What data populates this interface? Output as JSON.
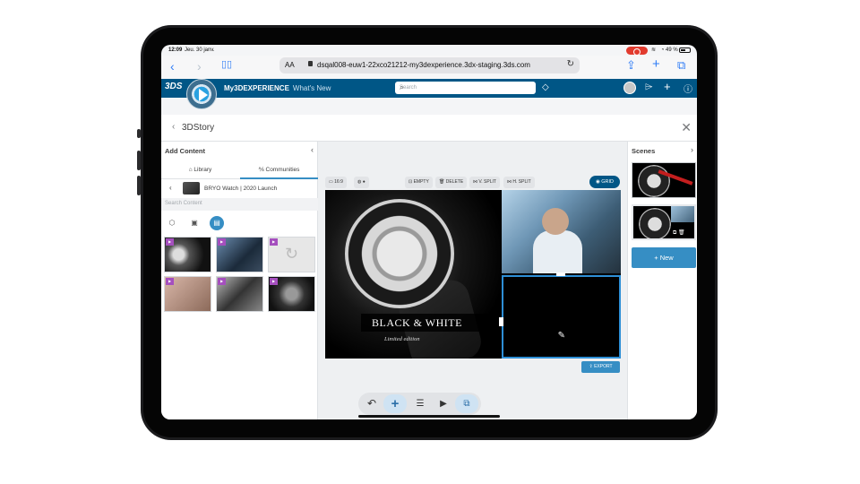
{
  "status": {
    "time": "12:09",
    "date": "Jeu. 30 janv.",
    "battery": "49 %"
  },
  "browser": {
    "text_size": "AA",
    "url": "dsqal008-euw1-22xco21212-my3dexperience.3dx-staging.3ds.com"
  },
  "topbar": {
    "logo": "3DS",
    "brand_bold": "My3DEXPERIENCE",
    "brand_sub": "What's New",
    "search_placeholder": "Search"
  },
  "app": {
    "title": "3DStory"
  },
  "left": {
    "heading": "Add Content",
    "tabs": [
      {
        "label": "Library"
      },
      {
        "label": "Communities"
      }
    ],
    "folder": "BRYO Watch | 2020 Launch",
    "search_placeholder": "Search Content"
  },
  "toolbar": {
    "ratio": "16:9",
    "buttons": [
      "EMPTY",
      "DELETE",
      "V. SPLIT",
      "H. SPLIT"
    ],
    "grid_label": "GRID",
    "export_label": "EXPORT"
  },
  "scene": {
    "title": "BLACK & WHITE",
    "subtitle": "Limited edition"
  },
  "right": {
    "heading": "Scenes",
    "new_label": "New"
  },
  "colors": {
    "ds_blue": "#005686",
    "accent": "#368ec4",
    "selection": "#2e8fd6",
    "badge": "#a54fbe"
  }
}
